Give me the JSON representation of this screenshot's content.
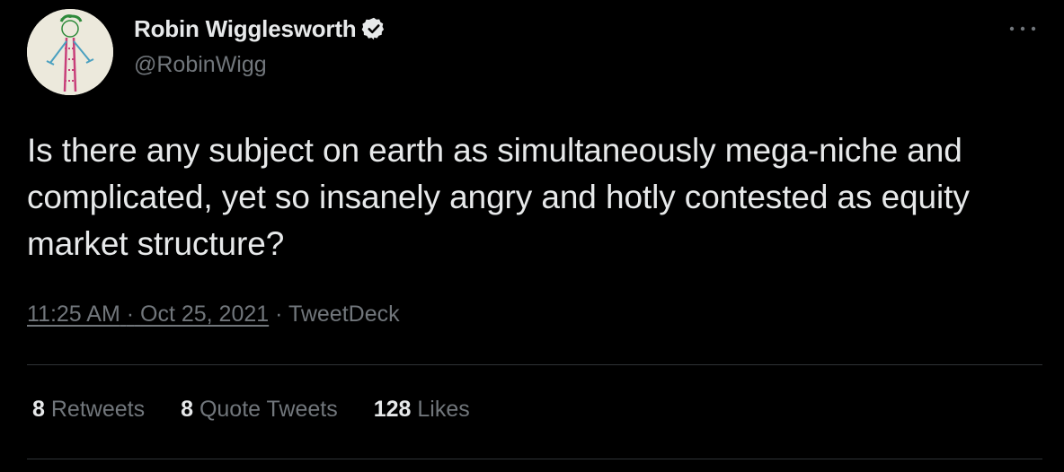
{
  "author": {
    "display_name": "Robin Wigglesworth",
    "handle": "@RobinWigg",
    "avatar_icon": "stick-figure-drawing-avatar",
    "verified_icon": "verified-badge-icon"
  },
  "tweet": {
    "text": "Is there any subject on earth as simultaneously mega-niche and complicated, yet so insanely angry and hotly contested as equity market structure?",
    "time": "11:25 AM",
    "separator": "·",
    "date": "Oct 25, 2021",
    "source": "TweetDeck"
  },
  "stats": {
    "retweets_count": "8",
    "retweets_label": "Retweets",
    "quotes_count": "8",
    "quotes_label": "Quote Tweets",
    "likes_count": "128",
    "likes_label": "Likes"
  },
  "colors": {
    "background": "#000000",
    "text_primary": "#e7e9ea",
    "text_secondary": "#71767b",
    "divider": "#2f3336"
  }
}
